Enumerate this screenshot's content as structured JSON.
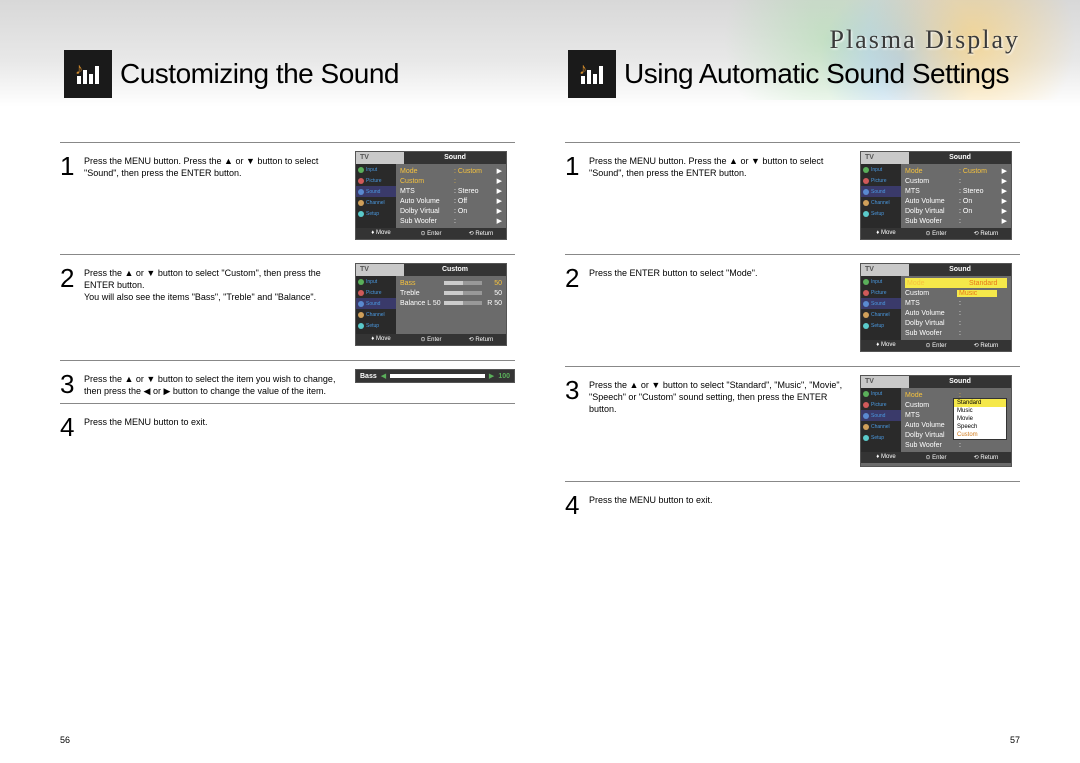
{
  "brand": "Plasma Display",
  "left": {
    "title": "Customizing the Sound",
    "steps": [
      "Press the MENU button. Press the ▲ or ▼ button to select \"Sound\", then press the ENTER button.",
      "Press the ▲ or ▼ button to select \"Custom\", then press the ENTER button.\nYou will also see the items \"Bass\", \"Treble\" and \"Balance\".",
      "Press the ▲ or ▼ button to select the item you wish to change, then press the ◀ or ▶ button to change the value of the item.",
      "Press the MENU button to exit."
    ],
    "page": "56"
  },
  "right": {
    "title": "Using Automatic Sound Settings",
    "steps": [
      "Press the MENU button. Press the ▲ or ▼ button to select \"Sound\", then press the ENTER button.",
      "Press the ENTER button to select \"Mode\".",
      "Press the ▲ or ▼ button to select \"Standard\", \"Music\", \"Movie\", \"Speech\" or \"Custom\" sound setting, then press the ENTER button.",
      "Press the MENU button to exit."
    ],
    "page": "57"
  },
  "osd": {
    "tv_label": "TV",
    "sound_title": "Sound",
    "custom_title": "Custom",
    "tabs": [
      "Input",
      "Picture",
      "Sound",
      "Channel",
      "Setup"
    ],
    "footer": {
      "move": "Move",
      "enter": "Enter",
      "return": "Return"
    },
    "menu1": [
      {
        "k": "Mode",
        "v": "Custom",
        "arr": "▶",
        "yk": true
      },
      {
        "k": "Custom",
        "v": "",
        "arr": "▶",
        "yk": true
      },
      {
        "k": "MTS",
        "v": "Stereo",
        "arr": "▶"
      },
      {
        "k": "Auto Volume",
        "v": "Off",
        "arr": "▶"
      },
      {
        "k": "Dolby Virtual",
        "v": "On",
        "arr": "▶"
      },
      {
        "k": "Sub Woofer",
        "v": "",
        "arr": "▶"
      }
    ],
    "menu2": [
      {
        "k": "Bass",
        "v": "50",
        "yk": true,
        "bar": 50
      },
      {
        "k": "Treble",
        "v": "50",
        "bar": 50
      },
      {
        "k": "Balance L 50",
        "v": "R 50",
        "bar": 50
      }
    ],
    "slider": {
      "label": "Bass",
      "value": "100"
    },
    "menuR1": [
      {
        "k": "Mode",
        "v": "Custom",
        "arr": "▶",
        "yk": true
      },
      {
        "k": "Custom",
        "v": "",
        "arr": "▶"
      },
      {
        "k": "MTS",
        "v": "Stereo",
        "arr": "▶"
      },
      {
        "k": "Auto Volume",
        "v": "On",
        "arr": "▶"
      },
      {
        "k": "Dolby Virtual",
        "v": "On",
        "arr": "▶"
      },
      {
        "k": "Sub Woofer",
        "v": "",
        "arr": "▶"
      }
    ],
    "menuR2": [
      {
        "k": "Mode",
        "v": "Standard",
        "hl": true,
        "yk": true,
        "orange": true
      },
      {
        "k": "Custom",
        "v": "Music",
        "hl2": true
      },
      {
        "k": "MTS",
        "v": ""
      },
      {
        "k": "Auto Volume",
        "v": ""
      },
      {
        "k": "Dolby Virtual",
        "v": ""
      },
      {
        "k": "Sub Woofer",
        "v": ""
      }
    ],
    "menuR3_items": [
      {
        "k": "Mode",
        "v": "",
        "yk": true
      },
      {
        "k": "Custom",
        "v": ""
      },
      {
        "k": "MTS",
        "v": ""
      },
      {
        "k": "Auto Volume",
        "v": ""
      },
      {
        "k": "Dolby Virtual",
        "v": ""
      },
      {
        "k": "Sub Woofer",
        "v": ""
      }
    ],
    "dropdown": [
      "Standard",
      "Music",
      "Movie",
      "Speech",
      "Custom"
    ]
  }
}
